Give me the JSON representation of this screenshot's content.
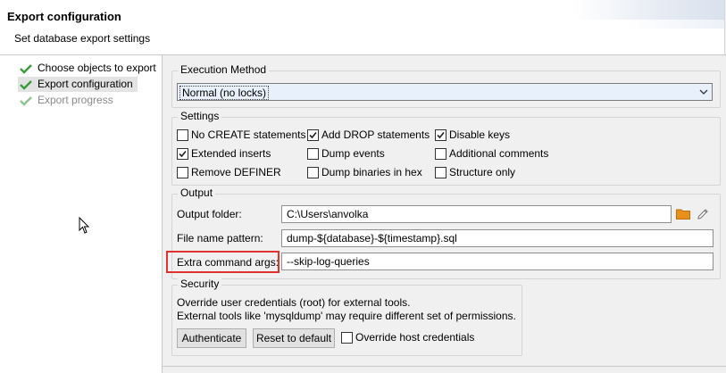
{
  "header": {
    "title": "Export configuration",
    "subtitle": "Set database export settings"
  },
  "nav": {
    "items": [
      {
        "label": "Choose objects to export",
        "state": "done"
      },
      {
        "label": "Export configuration",
        "state": "selected"
      },
      {
        "label": "Export progress",
        "state": "pending"
      }
    ]
  },
  "execution": {
    "group_title": "Execution Method",
    "selected": "Normal (no locks)"
  },
  "settings": {
    "group_title": "Settings",
    "options": [
      {
        "label": "No CREATE statements",
        "checked": false
      },
      {
        "label": "Add DROP statements",
        "checked": true
      },
      {
        "label": "Disable keys",
        "checked": true
      },
      {
        "label": "Extended inserts",
        "checked": true
      },
      {
        "label": "Dump events",
        "checked": false
      },
      {
        "label": "Additional comments",
        "checked": false
      },
      {
        "label": "Remove DEFINER",
        "checked": false
      },
      {
        "label": "Dump binaries in hex",
        "checked": false
      },
      {
        "label": "Structure only",
        "checked": false
      }
    ]
  },
  "output": {
    "group_title": "Output",
    "folder_label": "Output folder:",
    "folder_value": "C:\\Users\\anvolka",
    "pattern_label": "File name pattern:",
    "pattern_value": "dump-${database}-${timestamp}.sql",
    "extra_label": "Extra command args:",
    "extra_value": "--skip-log-queries"
  },
  "security": {
    "group_title": "Security",
    "line1": "Override user credentials (root) for external tools.",
    "line2": "External tools like 'mysqldump' may require different set of permissions.",
    "authenticate_label": "Authenticate",
    "reset_label": "Reset to default",
    "override_label": "Override host credentials",
    "override_checked": false
  },
  "colors": {
    "check_green": "#3b9b3b",
    "folder_orange": "#e8901c",
    "highlight_red": "#e0322f"
  },
  "icons": [
    "check-icon",
    "chevron-down-icon",
    "folder-icon",
    "edit-pencil-icon",
    "mouse-cursor-icon"
  ]
}
